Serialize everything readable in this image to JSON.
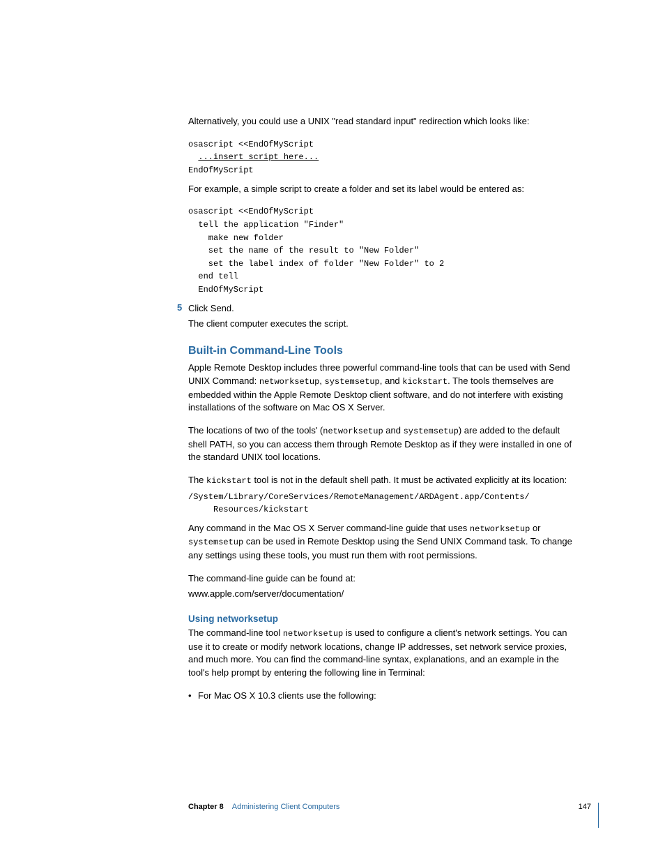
{
  "intro": {
    "p1": "Alternatively, you could use a UNIX \"read standard input\" redirection which looks like:"
  },
  "code1": {
    "l1": "osascript <<EndOfMyScript",
    "l2": "...insert script here...",
    "l3": "EndOfMyScript"
  },
  "p2": "For example, a simple script to create a folder and set its label would be entered as:",
  "code2": {
    "l1": "osascript <<EndOfMyScript",
    "l2": "  tell the application \"Finder\"",
    "l3": "    make new folder",
    "l4": "    set the name of the result to \"New Folder\"",
    "l5": "    set the label index of folder \"New Folder\" to 2",
    "l6": "  end tell",
    "l7": "  EndOfMyScript"
  },
  "step5": {
    "num": "5",
    "text": "Click Send.",
    "after": "The client computer executes the script."
  },
  "section": {
    "title": "Built-in Command-Line Tools",
    "p1a": "Apple Remote Desktop includes three powerful command-line tools that can be used with Send UNIX Command: ",
    "tool1": "networksetup",
    "c1": ", ",
    "tool2": "systemsetup",
    "c2": ", and ",
    "tool3": "kickstart",
    "p1b": ". The tools themselves are embedded within the Apple Remote Desktop client software, and do not interfere with existing installations of the software on Mac OS X Server.",
    "p2a": "The locations of two of the tools' (",
    "p2t1": "networksetup",
    "p2c": " and ",
    "p2t2": "systemsetup",
    "p2b": ") are added to the default shell PATH, so you can access them through Remote Desktop as if they were installed in one of the standard UNIX tool locations.",
    "p3a": "The ",
    "p3t": "kickstart",
    "p3b": " tool is not in the default shell path. It must be activated explicitly at its location:",
    "code3": "/System/Library/CoreServices/RemoteManagement/ARDAgent.app/Contents/\n     Resources/kickstart",
    "p4a": "Any command in the Mac OS X Server command-line guide that uses ",
    "p4t1": "networksetup",
    "p4c": " or ",
    "p4t2": "systemsetup",
    "p4b": " can be used in Remote Desktop using the Send UNIX Command task. To change any settings using these tools, you must run them with root permissions.",
    "p5": "The command-line guide can be found at:",
    "p5url": "www.apple.com/server/documentation/"
  },
  "sub": {
    "title": "Using networksetup",
    "p1a": "The command-line tool ",
    "p1t": "networksetup",
    "p1b": " is used to configure a client's network settings. You can use it to create or modify network locations, change IP addresses, set network service proxies, and much more. You can find the command-line syntax, explanations, and an example in the tool's help prompt by entering the following line in Terminal:",
    "bullet1": "For Mac OS X 10.3 clients use the following:"
  },
  "footer": {
    "chapter": "Chapter 8",
    "title": "Administering Client Computers",
    "page": "147"
  }
}
